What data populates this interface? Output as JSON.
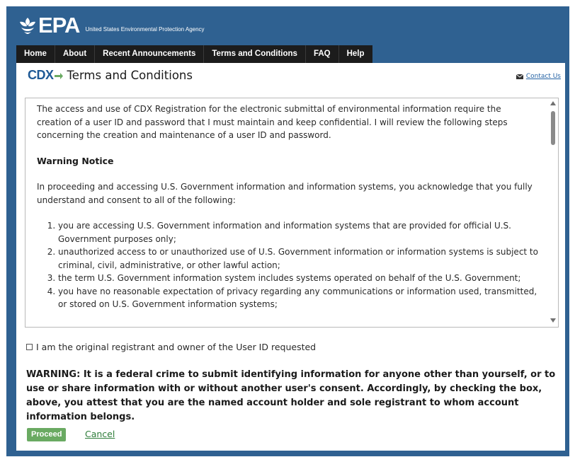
{
  "header": {
    "logo_text": "EPA",
    "agency_name": "United States Environmental Protection Agency"
  },
  "nav": {
    "items": [
      "Home",
      "About",
      "Recent Announcements",
      "Terms and Conditions",
      "FAQ",
      "Help"
    ]
  },
  "page": {
    "brand": "CDX",
    "title": "Terms and Conditions",
    "contact_link": "Contact Us"
  },
  "terms": {
    "intro": "The access and use of CDX Registration for the electronic submittal of environmental information require the creation of a user ID and password that I must maintain and keep confidential. I will review the following steps concerning the creation and maintenance of a user ID and password.",
    "warning_heading": "Warning Notice",
    "proceeding": "In proceeding and accessing U.S. Government information and information systems, you acknowledge that you fully understand and consent to all of the following:",
    "items": [
      "you are accessing U.S. Government information and information systems that are provided for official U.S. Government purposes only;",
      "unauthorized access to or unauthorized use of U.S. Government information or information systems is subject to criminal, civil, administrative, or other lawful action;",
      "the term U.S. Government information system includes systems operated on behalf of the U.S. Government;",
      "you have no reasonable expectation of privacy regarding any communications or information used, transmitted, or stored on U.S. Government information systems;"
    ]
  },
  "form": {
    "checkbox_label": "I am the original registrant and owner of the User ID requested",
    "checkbox_checked": false,
    "warning_text": "WARNING: It is a federal crime to submit identifying information for anyone other than yourself, or to use or share information with or without another user's consent. Accordingly, by checking the box, above, you attest that you are the named account holder and sole registrant to whom account information belongs.",
    "proceed_label": "Proceed",
    "cancel_label": "Cancel"
  },
  "colors": {
    "banner": "#2f6191",
    "nav": "#1c1c1c",
    "proceed": "#6aaa62",
    "link": "#2563a5"
  }
}
